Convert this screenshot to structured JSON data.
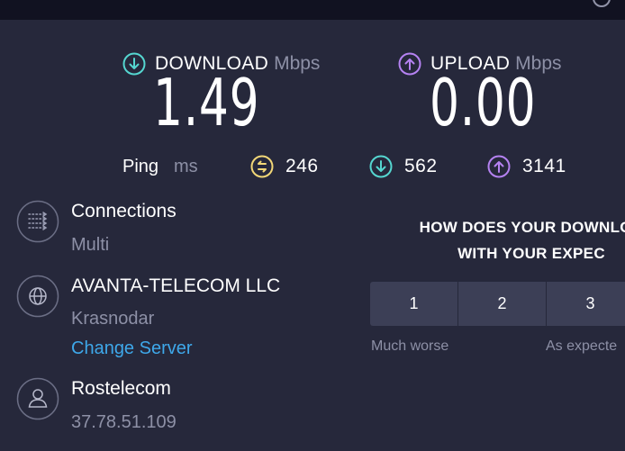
{
  "download": {
    "label": "DOWNLOAD",
    "unit": "Mbps",
    "value": "1.49",
    "icon": "arrow-down-circle-icon",
    "color": "#55d6d0"
  },
  "upload": {
    "label": "UPLOAD",
    "unit": "Mbps",
    "value": "0.00",
    "icon": "arrow-up-circle-icon",
    "color": "#b582f2"
  },
  "ping": {
    "label": "Ping",
    "unit": "ms",
    "idle": {
      "value": "246",
      "icon": "ping-idle-icon",
      "color": "#f2d777"
    },
    "download": {
      "value": "562",
      "icon": "ping-download-icon",
      "color": "#55d6d0"
    },
    "upload": {
      "value": "3141",
      "icon": "ping-upload-icon",
      "color": "#b582f2"
    }
  },
  "connections": {
    "title": "Connections",
    "value": "Multi",
    "icon": "connections-icon"
  },
  "server": {
    "name": "AVANTA-TELECOM LLC",
    "location": "Krasnodar",
    "change_label": "Change Server",
    "icon": "globe-icon"
  },
  "provider": {
    "name": "Rostelecom",
    "ip": "37.78.51.109",
    "icon": "user-icon"
  },
  "survey": {
    "line1": "HOW DOES YOUR DOWNLOA",
    "line2": "WITH YOUR EXPEC",
    "options": [
      "1",
      "2",
      "3"
    ],
    "scale_low": "Much worse",
    "scale_mid": "As expecte"
  }
}
